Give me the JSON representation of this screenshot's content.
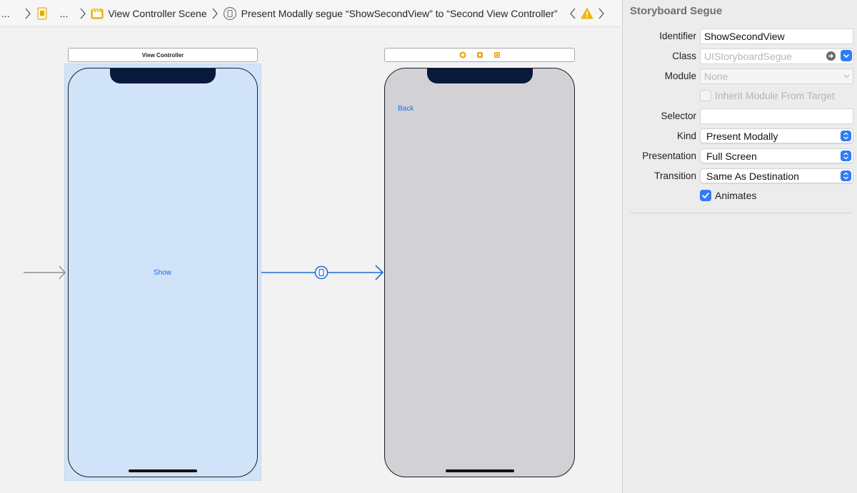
{
  "jumpbar": {
    "crumb1": "...",
    "crumb2": "...",
    "crumb3": "View Controller Scene",
    "crumb4": "Present Modally segue “ShowSecondView” to “Second View Controller”"
  },
  "canvas": {
    "scene1_title": "View Controller",
    "show_button": "Show",
    "back_button": "Back"
  },
  "inspector": {
    "title": "Storyboard Segue",
    "identifier_label": "Identifier",
    "identifier_value": "ShowSecondView",
    "class_label": "Class",
    "class_placeholder": "UIStoryboardSegue",
    "module_label": "Module",
    "module_placeholder": "None",
    "inherit_label": "Inherit Module From Target",
    "selector_label": "Selector",
    "selector_value": "",
    "kind_label": "Kind",
    "kind_value": "Present Modally",
    "presentation_label": "Presentation",
    "presentation_value": "Full Screen",
    "transition_label": "Transition",
    "transition_value": "Same As Destination",
    "animates_label": "Animates"
  },
  "colors": {
    "accent": "#2f7cf6",
    "segue_line": "#1f6bd1",
    "selection": "#d1e3f9",
    "second_vc_bg": "#d2d2d6",
    "notch": "#071a3b",
    "warning": "#f5b800"
  },
  "icons": [
    "chevron-right-icon",
    "storyboard-file-icon",
    "scene-icon",
    "segue-icon",
    "chevron-left-icon",
    "warning-icon",
    "checkmark-icon",
    "arrow-right-circle-icon",
    "chevron-down-icon",
    "updown-chevron-icon"
  ]
}
